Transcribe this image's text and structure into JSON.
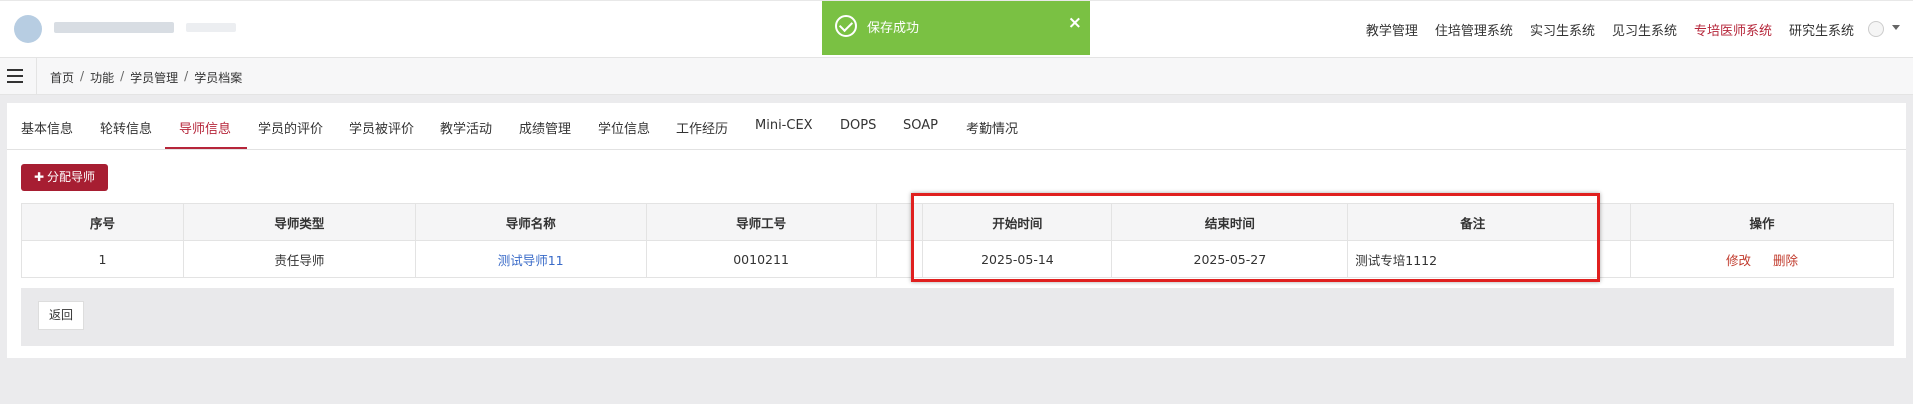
{
  "header": {
    "nav": [
      "教学管理",
      "住培管理系统",
      "实习生系统",
      "见习生系统",
      "专培医师系统",
      "研究生系统"
    ],
    "active_nav": "专培医师系统"
  },
  "toast": {
    "message": "保存成功",
    "close_label": "×"
  },
  "breadcrumb": [
    "首页",
    "功能",
    "学员管理",
    "学员档案"
  ],
  "tabs": [
    {
      "label": "基本信息"
    },
    {
      "label": "轮转信息"
    },
    {
      "label": "导师信息",
      "active": true
    },
    {
      "label": "学员的评价"
    },
    {
      "label": "学员被评价"
    },
    {
      "label": "教学活动"
    },
    {
      "label": "成绩管理"
    },
    {
      "label": "学位信息"
    },
    {
      "label": "工作经历"
    },
    {
      "label": "Mini-CEX"
    },
    {
      "label": "DOPS"
    },
    {
      "label": "SOAP"
    },
    {
      "label": "考勤情况"
    }
  ],
  "toolbar": {
    "assign_label": "分配导师"
  },
  "table": {
    "headers": [
      "序号",
      "导师类型",
      "导师名称",
      "导师工号",
      "",
      "开始时间",
      "结束时间",
      "备注",
      "",
      "操作"
    ],
    "rows": [
      {
        "index": "1",
        "type": "责任导师",
        "name": "测试导师11",
        "id": "0010211",
        "start": "2025-05-14",
        "end": "2025-05-27",
        "remark": "测试专培1112",
        "edit": "修改",
        "delete": "删除"
      }
    ]
  },
  "footer": {
    "back_label": "返回"
  },
  "colors": {
    "accent": "#b6263a",
    "toast_bg": "#7ac143",
    "highlight": "#e0201f",
    "link": "#3a6bc8"
  }
}
